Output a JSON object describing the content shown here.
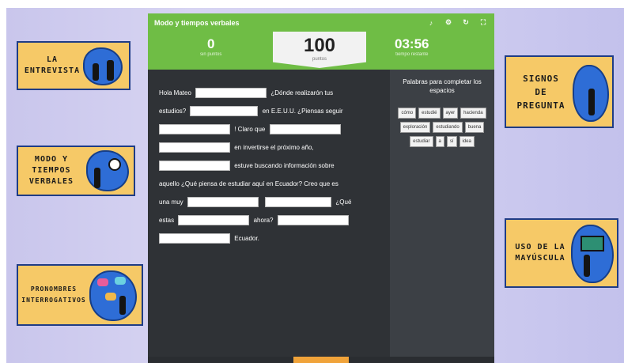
{
  "app": {
    "title": "Modo y tiempos verbales",
    "score_value": "0",
    "score_label": "sin puntos",
    "points_value": "100",
    "points_label": "puntos",
    "timer_value": "03:56",
    "timer_label": "tiempo restante"
  },
  "cards": {
    "left_1": "LA\nENTREVISTA",
    "left_2": "MODO Y\nTIEMPOS\nVERBALES",
    "left_3": "PRONOMBRES\nINTERROGATIVOS",
    "right_1": "SIGNOS\nDE\nPREGUNTA",
    "right_2": "USO DE LA\nMAYÚSCULA"
  },
  "exercise": {
    "t1": "Hola Mateo",
    "t2": "¿Dónde realizarón tus",
    "t3": "estudios?",
    "t4": "en E.E.U.U. ¿Piensas seguir",
    "t5": "! Claro que",
    "t6": "en invertirse el próximo año,",
    "t7": "estuve buscando información sobre",
    "t8": "aquello ¿Qué piensa de estudiar aquí en Ecuador? Creo que es",
    "t9": "una muy",
    "t10": "¿Qué",
    "t11": "estas",
    "t12": "ahora?",
    "t13": "Ecuador."
  },
  "words_panel": {
    "header": "Palabras para completar los espacios",
    "words": [
      "cómo",
      "estudié",
      "ayer",
      "hacienda",
      "exploración",
      "estudiando",
      "buena",
      "estudiar",
      "a",
      "sí",
      "idea"
    ]
  },
  "colors": {
    "green": "#6fbd45",
    "card": "#f6c967",
    "dark": "#2f3236"
  }
}
